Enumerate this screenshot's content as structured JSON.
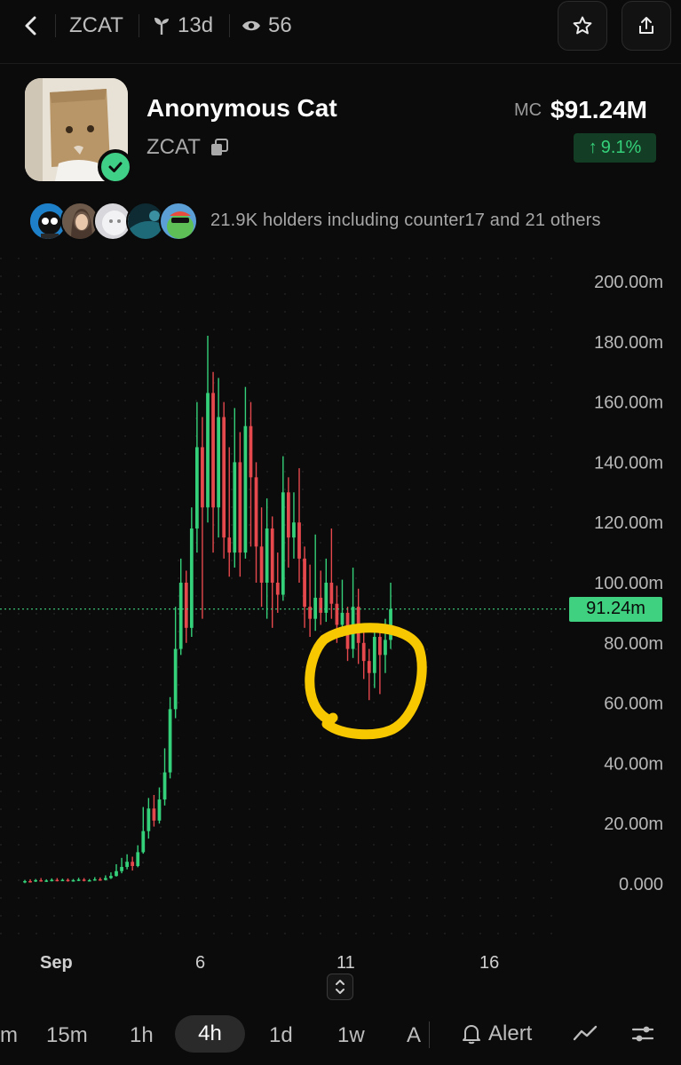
{
  "topbar": {
    "symbol": "ZCAT",
    "age": "13d",
    "watchers": "56",
    "icons": [
      "back-chevron-icon",
      "sprout-icon",
      "eye-icon",
      "star-icon",
      "share-icon"
    ]
  },
  "token": {
    "name": "Anonymous Cat",
    "symbol": "ZCAT",
    "mc_label": "MC",
    "mc_value": "$91.24M",
    "change": "9.1%",
    "change_arrow": "↑",
    "up_color": "#35d07a",
    "down_color": "#e5484d"
  },
  "holders": {
    "text": "21.9K holders including counter17 and 21 others"
  },
  "chart": {
    "current_price_label": "91.24m",
    "xlabels": [
      "Sep",
      "6",
      "11",
      "16"
    ]
  },
  "chart_data": {
    "type": "candlestick",
    "ylim": [
      0,
      200
    ],
    "yticks": [
      "200.00m",
      "180.00m",
      "160.00m",
      "140.00m",
      "120.00m",
      "100.00m",
      "80.00m",
      "60.00m",
      "40.00m",
      "20.00m",
      "0.000"
    ],
    "current_price": 91.24,
    "candles": [
      {
        "o": 0.5,
        "c": 0.9,
        "h": 1.3,
        "l": 0.2
      },
      {
        "o": 0.9,
        "c": 0.8,
        "h": 1.5,
        "l": 0.4
      },
      {
        "o": 0.8,
        "c": 1.2,
        "h": 1.6,
        "l": 0.6
      },
      {
        "o": 1.2,
        "c": 1.0,
        "h": 1.9,
        "l": 0.7
      },
      {
        "o": 1.0,
        "c": 1.1,
        "h": 1.5,
        "l": 0.6
      },
      {
        "o": 1.1,
        "c": 1.3,
        "h": 1.8,
        "l": 0.8
      },
      {
        "o": 1.3,
        "c": 1.1,
        "h": 1.9,
        "l": 0.8
      },
      {
        "o": 1.1,
        "c": 1.3,
        "h": 1.7,
        "l": 0.9
      },
      {
        "o": 1.3,
        "c": 1.0,
        "h": 1.8,
        "l": 0.7
      },
      {
        "o": 1.0,
        "c": 1.2,
        "h": 1.6,
        "l": 0.7
      },
      {
        "o": 1.2,
        "c": 1.4,
        "h": 2.0,
        "l": 0.9
      },
      {
        "o": 1.4,
        "c": 1.1,
        "h": 1.9,
        "l": 0.8
      },
      {
        "o": 1.1,
        "c": 1.2,
        "h": 1.6,
        "l": 0.8
      },
      {
        "o": 1.2,
        "c": 1.5,
        "h": 2.2,
        "l": 1.0
      },
      {
        "o": 1.5,
        "c": 1.3,
        "h": 2.1,
        "l": 1.0
      },
      {
        "o": 1.3,
        "c": 1.9,
        "h": 2.8,
        "l": 1.1
      },
      {
        "o": 1.9,
        "c": 2.6,
        "h": 3.8,
        "l": 1.6
      },
      {
        "o": 2.6,
        "c": 4.2,
        "h": 6.5,
        "l": 2.4
      },
      {
        "o": 4.2,
        "c": 5.6,
        "h": 8.6,
        "l": 3.5
      },
      {
        "o": 5.6,
        "c": 7.3,
        "h": 9.8,
        "l": 4.8
      },
      {
        "o": 7.3,
        "c": 5.9,
        "h": 9.0,
        "l": 4.4
      },
      {
        "o": 5.9,
        "c": 10.5,
        "h": 12.8,
        "l": 5.5
      },
      {
        "o": 10.5,
        "c": 17.5,
        "h": 25.5,
        "l": 10.0
      },
      {
        "o": 17.5,
        "c": 25.0,
        "h": 28.5,
        "l": 15.0
      },
      {
        "o": 25.0,
        "c": 21.0,
        "h": 29.5,
        "l": 19.0
      },
      {
        "o": 21.0,
        "c": 28.0,
        "h": 32.0,
        "l": 20.0
      },
      {
        "o": 28.0,
        "c": 37.0,
        "h": 45.0,
        "l": 26.0
      },
      {
        "o": 37.0,
        "c": 58.0,
        "h": 62.0,
        "l": 35.0
      },
      {
        "o": 58.0,
        "c": 78.0,
        "h": 92.0,
        "l": 55.0
      },
      {
        "o": 78.0,
        "c": 100.0,
        "h": 108.0,
        "l": 76.0
      },
      {
        "o": 100.0,
        "c": 85.0,
        "h": 104.0,
        "l": 80.0
      },
      {
        "o": 85.0,
        "c": 118.0,
        "h": 125.0,
        "l": 82.0
      },
      {
        "o": 118.0,
        "c": 145.0,
        "h": 160.0,
        "l": 110.0
      },
      {
        "o": 145.0,
        "c": 125.0,
        "h": 155.0,
        "l": 88.0
      },
      {
        "o": 125.0,
        "c": 163.0,
        "h": 182.0,
        "l": 120.0
      },
      {
        "o": 163.0,
        "c": 125.0,
        "h": 170.0,
        "l": 110.0
      },
      {
        "o": 125.0,
        "c": 155.0,
        "h": 168.0,
        "l": 115.0
      },
      {
        "o": 155.0,
        "c": 115.0,
        "h": 160.0,
        "l": 108.0
      },
      {
        "o": 115.0,
        "c": 110.0,
        "h": 145.0,
        "l": 102.0
      },
      {
        "o": 110.0,
        "c": 140.0,
        "h": 158.0,
        "l": 105.0
      },
      {
        "o": 140.0,
        "c": 110.0,
        "h": 150.0,
        "l": 102.0
      },
      {
        "o": 110.0,
        "c": 152.0,
        "h": 165.0,
        "l": 108.0
      },
      {
        "o": 152.0,
        "c": 135.0,
        "h": 160.0,
        "l": 112.0
      },
      {
        "o": 135.0,
        "c": 112.0,
        "h": 140.0,
        "l": 100.0
      },
      {
        "o": 112.0,
        "c": 100.0,
        "h": 125.0,
        "l": 92.0
      },
      {
        "o": 100.0,
        "c": 118.0,
        "h": 128.0,
        "l": 88.0
      },
      {
        "o": 118.0,
        "c": 100.0,
        "h": 122.0,
        "l": 85.0
      },
      {
        "o": 100.0,
        "c": 96.0,
        "h": 110.0,
        "l": 90.0
      },
      {
        "o": 96.0,
        "c": 130.0,
        "h": 142.0,
        "l": 94.0
      },
      {
        "o": 130.0,
        "c": 115.0,
        "h": 135.0,
        "l": 105.0
      },
      {
        "o": 115.0,
        "c": 120.0,
        "h": 130.0,
        "l": 108.0
      },
      {
        "o": 120.0,
        "c": 108.0,
        "h": 138.0,
        "l": 100.0
      },
      {
        "o": 108.0,
        "c": 92.0,
        "h": 112.0,
        "l": 85.0
      },
      {
        "o": 92.0,
        "c": 88.0,
        "h": 106.0,
        "l": 82.0
      },
      {
        "o": 88.0,
        "c": 95.0,
        "h": 116.0,
        "l": 84.0
      },
      {
        "o": 95.0,
        "c": 90.0,
        "h": 104.0,
        "l": 86.0
      },
      {
        "o": 90.0,
        "c": 100.0,
        "h": 108.0,
        "l": 87.0
      },
      {
        "o": 100.0,
        "c": 93.0,
        "h": 118.0,
        "l": 88.0
      },
      {
        "o": 93.0,
        "c": 86.0,
        "h": 99.0,
        "l": 80.0
      },
      {
        "o": 86.0,
        "c": 90.0,
        "h": 101.0,
        "l": 82.0
      },
      {
        "o": 90.0,
        "c": 78.0,
        "h": 92.0,
        "l": 74.0
      },
      {
        "o": 78.0,
        "c": 92.0,
        "h": 105.0,
        "l": 75.0
      },
      {
        "o": 92.0,
        "c": 80.0,
        "h": 98.0,
        "l": 73.0
      },
      {
        "o": 80.0,
        "c": 74.0,
        "h": 84.0,
        "l": 68.0
      },
      {
        "o": 74.0,
        "c": 70.0,
        "h": 78.0,
        "l": 61.0
      },
      {
        "o": 70.0,
        "c": 82.0,
        "h": 86.0,
        "l": 65.0
      },
      {
        "o": 82.0,
        "c": 76.0,
        "h": 84.0,
        "l": 63.0
      },
      {
        "o": 76.0,
        "c": 81.0,
        "h": 88.0,
        "l": 70.0
      },
      {
        "o": 81.0,
        "c": 91.24,
        "h": 100.0,
        "l": 78.0
      }
    ]
  },
  "timeframes": {
    "items": [
      "m",
      "15m",
      "1h",
      "4h",
      "1d",
      "1w",
      "A"
    ],
    "active": "4h",
    "alert_label": "Alert"
  }
}
